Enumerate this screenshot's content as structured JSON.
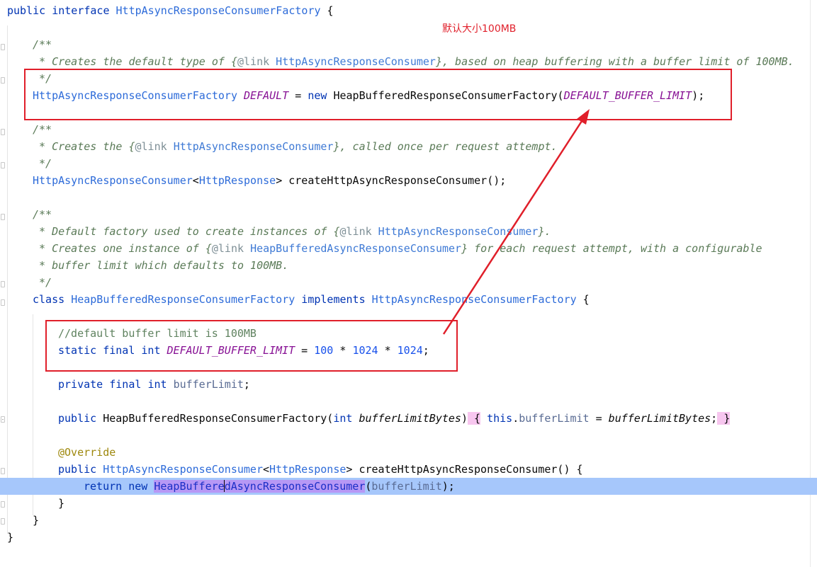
{
  "annotation": {
    "label": "默认大小100MB"
  },
  "code": {
    "l1_kw1": "public",
    "l1_kw2": "interface",
    "l1_name": "HttpAsyncResponseConsumerFactory",
    "l1_brace": " {",
    "doc_open": "/**",
    "doc1_a": " * Creates the default type of {",
    "doc1_link": "@link",
    "doc1_ref": "HttpAsyncResponseConsumer",
    "doc1_b": "}, based on heap buffering with a buffer limit of 100MB.",
    "doc_close": " */",
    "default_type": "HttpAsyncResponseConsumerFactory",
    "default_name": "DEFAULT",
    "default_eq": " = ",
    "default_new": "new",
    "default_ctor": "HeapBufferedResponseConsumerFactory(",
    "default_arg": "DEFAULT_BUFFER_LIMIT",
    "default_end": ");",
    "doc2_a": " * Creates the {",
    "doc2_link": "@link",
    "doc2_ref": "HttpAsyncResponseConsumer",
    "doc2_b": "}, called once per request attempt.",
    "create_type": "HttpAsyncResponseConsumer",
    "create_lt": "<",
    "create_generic": "HttpResponse",
    "create_gt": ">",
    "create_method": " createHttpAsyncResponseConsumer();",
    "doc3_a": " * Default factory used to create instances of {",
    "doc3_link": "@link",
    "doc3_ref": "HttpAsyncResponseConsumer",
    "doc3_b": "}.",
    "doc4_a": " * Creates one instance of {",
    "doc4_link": "@link",
    "doc4_ref": "HeapBufferedAsyncResponseConsumer",
    "doc4_b": "} for each request attempt, with a configurable",
    "doc5": " * buffer limit which defaults to 100MB.",
    "class_kw": "class",
    "class_name": "HeapBufferedResponseConsumerFactory",
    "class_impl": "implements",
    "class_iface": "HttpAsyncResponseConsumerFactory",
    "class_brace": " {",
    "comment_line": "//default buffer limit is 100MB",
    "static_kw": "static",
    "final_kw": "final",
    "int_kw": "int",
    "limit_name": "DEFAULT_BUFFER_LIMIT",
    "limit_eq": " = ",
    "limit_n1": "100",
    "limit_op1": " * ",
    "limit_n2": "1024",
    "limit_op2": " * ",
    "limit_n3": "1024",
    "limit_end": ";",
    "private_kw": "private",
    "private_final": "final",
    "private_int": "int",
    "field_name": "bufferLimit",
    "field_end": ";",
    "ctor_public": "public",
    "ctor_name": "HeapBufferedResponseConsumerFactory(",
    "ctor_int": "int",
    "ctor_param": "bufferLimitBytes",
    "ctor_close": ")",
    "ctor_lbrace": " {",
    "ctor_this": "this",
    "ctor_dot": ".",
    "ctor_field": "bufferLimit",
    "ctor_eq": " = ",
    "ctor_param2": "bufferLimitBytes",
    "ctor_semi": ";",
    "ctor_rbrace": " }",
    "override": "@Override",
    "m_public": "public",
    "m_type": "HttpAsyncResponseConsumer",
    "m_lt": "<",
    "m_generic": "HttpResponse",
    "m_gt": ">",
    "m_name": " createHttpAsyncResponseConsumer() {",
    "ret_kw": "return",
    "ret_new": "new",
    "ret_cls_a": "HeapBuffere",
    "ret_cls_b": "dAsyncResponseConsumer",
    "ret_open": "(",
    "ret_field": "bufferLimit",
    "ret_end": ");",
    "close_method": "}",
    "close_class": "}",
    "close_iface": "}"
  },
  "colors": {
    "keyword": "#0033b3",
    "type": "#2d6bd9",
    "constant": "#871094",
    "doc": "#5a7a57",
    "annotation_red": "#e01f2a",
    "current_line": "#a6c7fb",
    "usage_highlight": "#b798f5",
    "brace_highlight": "#f7c6ef"
  }
}
